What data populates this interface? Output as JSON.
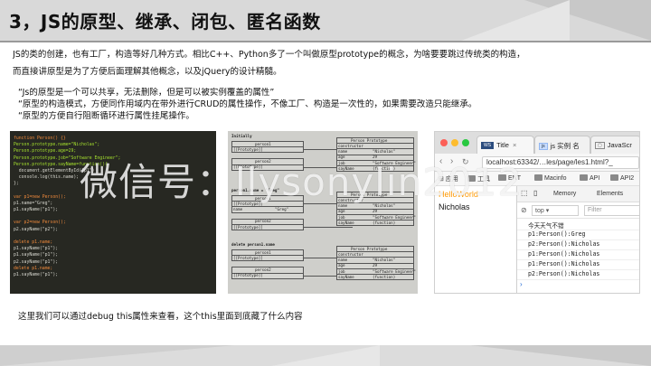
{
  "slide": {
    "title": "3，JS的原型、继承、闭包、匿名函数",
    "para1": "JS的类的创建，也有工厂，构造等好几种方式。相比C++、Python多了一个叫做原型prototype的概念，为啥要要跳过传统类的构造，",
    "para2": "而直接讲原型是为了方便后面理解其他概念，以及jQuery的设计精髓。",
    "quotes": [
      "“Js的原型是一个可以共享，无法删除，但是可以被实例覆盖的属性”",
      "“原型的构造模式，方便同作用域内在带外进行CRUD的属性操作，不像工厂、构造是一次性的，如果需要改造只能继承。",
      "“原型的方便自行阻断循环进行属性挂尾操作。"
    ],
    "footer": "这里我们可以通过debug this属性来查看，这个this里面到底藏了什么内容",
    "watermark": "微信号：llysonylin2012"
  },
  "code": {
    "lines": [
      "function Person() {}",
      "Person.prototype.name=\"Nicholas\";",
      "Person.prototype.age=29;",
      "Person.prototype.job=\"Software Engineer\";",
      "Person.prototype.sayName=function(){",
      "  document.getElementById(\"p1\")",
      "  console.log(this.name);",
      "};",
      "",
      "var p1=new Person();",
      "p1.name=\"Greg\";",
      "p1.sayName(\"p1\");",
      "",
      "var p2=new Person();",
      "p2.sayName(\"p2\");",
      "",
      "delete p1.name;",
      "p1.sayName(\"p1\");",
      "p1.sayName(\"p1\");",
      "p2.sayName(\"p1\");",
      "delete p1.name;",
      "p1.sayName(\"p1\");"
    ]
  },
  "diagram": {
    "sections": [
      {
        "caption": "Initially",
        "proto_title": "Person Prototype",
        "instances": [
          {
            "title": "person1",
            "rows": [
              [
                "[[Prototype]]",
                ""
              ]
            ]
          },
          {
            "title": "person2",
            "rows": [
              [
                "[[Prototype]]",
                ""
              ]
            ]
          }
        ],
        "proto_rows": [
          [
            "constructor",
            ""
          ],
          [
            "name",
            "\"Nicholas\""
          ],
          [
            "age",
            "29"
          ],
          [
            "job",
            "\"Software Engineer\""
          ],
          [
            "sayName",
            "(function)"
          ]
        ]
      },
      {
        "caption": "person1.name = \"Greg\"",
        "proto_title": "Person Prototype",
        "instances": [
          {
            "title": "person1",
            "rows": [
              [
                "[[Prototype]]",
                ""
              ],
              [
                "name",
                "\"Greg\""
              ]
            ]
          },
          {
            "title": "person2",
            "rows": [
              [
                "[[Prototype]]",
                ""
              ]
            ]
          }
        ],
        "proto_rows": [
          [
            "constructor",
            ""
          ],
          [
            "name",
            "\"Nicholas\""
          ],
          [
            "age",
            "29"
          ],
          [
            "job",
            "\"Software Engineer\""
          ],
          [
            "sayName",
            "(function)"
          ]
        ]
      },
      {
        "caption": "delete person1.name",
        "proto_title": "Person Prototype",
        "instances": [
          {
            "title": "person1",
            "rows": [
              [
                "[[Prototype]]",
                ""
              ]
            ]
          },
          {
            "title": "person2",
            "rows": [
              [
                "[[Prototype]]",
                ""
              ]
            ]
          }
        ],
        "proto_rows": [
          [
            "constructor",
            ""
          ],
          [
            "name",
            "\"Nicholas\""
          ],
          [
            "age",
            "29"
          ],
          [
            "job",
            "\"Software Engineer\""
          ],
          [
            "sayName",
            "(function)"
          ]
        ]
      }
    ]
  },
  "browser": {
    "tabs": [
      {
        "favicon": "WS",
        "label": "Title"
      },
      {
        "favicon": "js",
        "label": "js 实例 名"
      },
      {
        "favicon": "",
        "label": "JavaScr"
      }
    ],
    "address": "localhost:63342/…les/page/les1.html?_",
    "bookmarks": [
      "应用",
      "工具",
      "ENT",
      "Macinfo",
      "API",
      "API2"
    ],
    "page_lines": [
      "HelloWorld",
      "Nicholas"
    ],
    "devtools": {
      "tabs": [
        "Memory",
        "Elements"
      ],
      "context": "top",
      "filter_placeholder": "Filter",
      "console": [
        "今天天气不错",
        "p1:Person():Greg",
        "p2:Person():Nicholas",
        "p1:Person():Nicholas",
        "p1:Person():Nicholas",
        "p2:Person():Nicholas"
      ]
    }
  }
}
